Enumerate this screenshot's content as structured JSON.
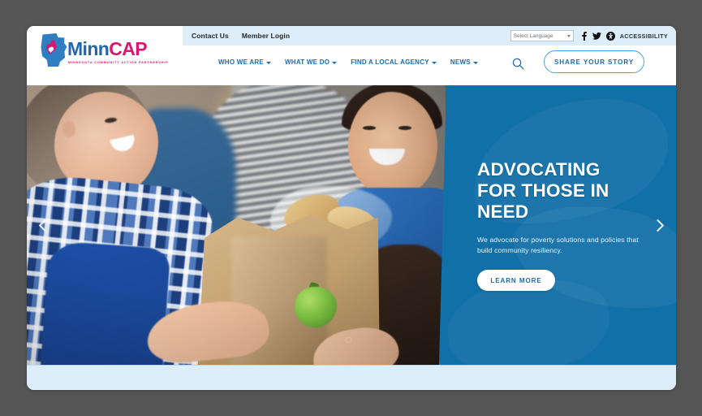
{
  "window": {
    "background_color": "#555555",
    "page_background": "#ffffff"
  },
  "utility_bar": {
    "background_color": "#ddeefa",
    "links": [
      {
        "label": "Contact Us",
        "name": "contact-us"
      },
      {
        "label": "Member Login",
        "name": "member-login"
      }
    ],
    "language_select": {
      "value": "Select Language",
      "options": [
        "Select Language"
      ]
    },
    "social": [
      {
        "name": "facebook-icon",
        "label": "Facebook"
      },
      {
        "name": "twitter-icon",
        "label": "Twitter"
      },
      {
        "name": "accessibility-circle-icon",
        "label": "Accessibility options"
      }
    ],
    "accessibility_label": "ACCESSIBILITY"
  },
  "logo": {
    "word_first": "Minn",
    "word_second": "CAP",
    "tagline": "MINNESOTA COMMUNITY ACTION PARTNERSHIP",
    "color_blue": "#2166ae",
    "color_pink": "#d6186f"
  },
  "nav": {
    "items": [
      {
        "label": "WHO WE ARE",
        "has_dropdown": true
      },
      {
        "label": "WHAT WE DO",
        "has_dropdown": true
      },
      {
        "label": "FIND A LOCAL AGENCY",
        "has_dropdown": true
      },
      {
        "label": "NEWS",
        "has_dropdown": true
      }
    ],
    "search_icon": "search-icon",
    "share_button": "SHARE YOUR STORY",
    "link_color": "#1f69ad"
  },
  "hero": {
    "panel_color": "#1270a8",
    "title": "ADVOCATING FOR THOSE IN NEED",
    "subtitle": "We advocate for poverty solutions and policies that build community resiliency.",
    "cta_label": "LEARN MORE",
    "prev_label": "Previous slide",
    "next_label": "Next slide",
    "image_alt": "Volunteers smiling while handing over a paper grocery bag of food"
  }
}
